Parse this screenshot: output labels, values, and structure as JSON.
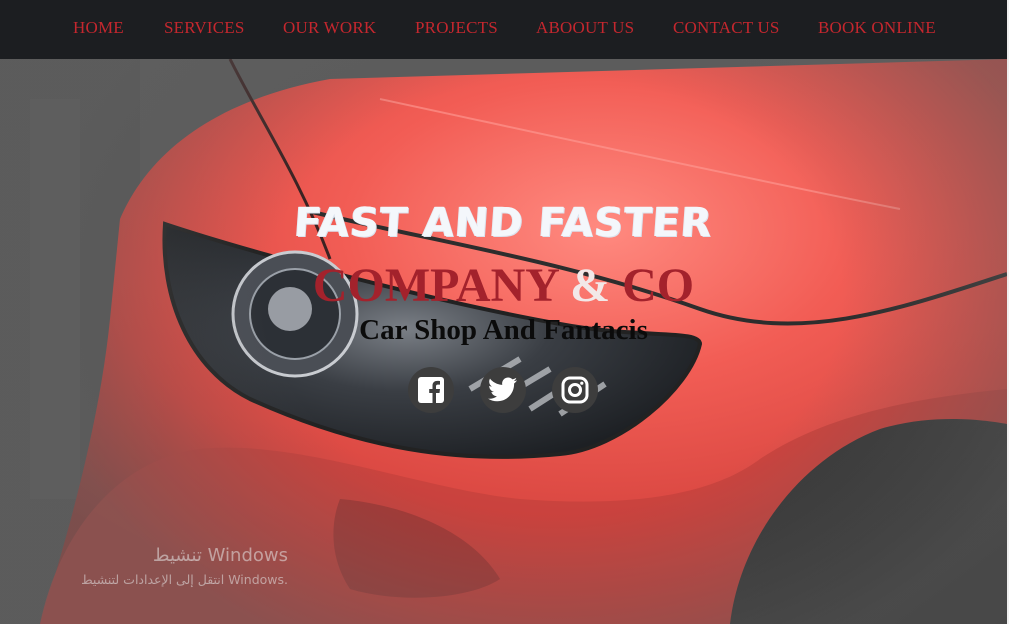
{
  "nav": {
    "items": [
      {
        "label": "HOME"
      },
      {
        "label": "SERVICES"
      },
      {
        "label": "OUR WORK"
      },
      {
        "label": "PROJECTS"
      },
      {
        "label": "ABOOUT US"
      },
      {
        "label": "CONTACT US"
      },
      {
        "label": "BOOK ONLINE"
      }
    ],
    "text_color": "#c4272e",
    "background": "#1c1e21"
  },
  "hero": {
    "headline": "FAST AND FASTER",
    "company_part1": "COMPANY ",
    "company_amp": "&",
    "company_part2": " CO",
    "subtitle": "Car Shop And Fantacis",
    "accent_color": "#a3222c"
  },
  "social": [
    {
      "icon": "facebook-icon"
    },
    {
      "icon": "twitter-icon"
    },
    {
      "icon": "instagram-icon"
    }
  ],
  "watermark": {
    "title": "تنشيط Windows",
    "subtitle": "انتقل إلى الإعدادات لتنشيط Windows."
  }
}
